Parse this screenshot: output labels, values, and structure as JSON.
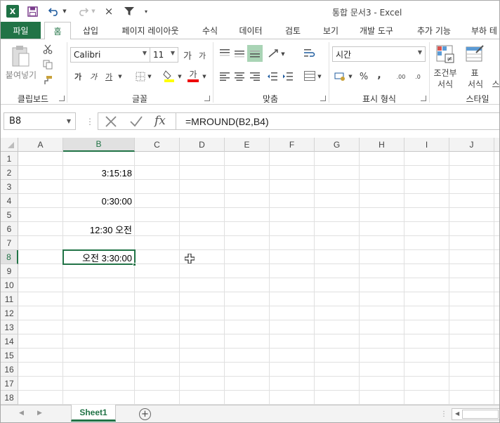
{
  "window": {
    "title": "통합 문서3 - Excel"
  },
  "qat": {
    "excel_icon": "X",
    "save_icon": "save-icon",
    "undo_icon": "undo-icon",
    "redo_icon": "redo-icon",
    "close_icon": "×",
    "filter_icon": "filter-icon"
  },
  "tabs": {
    "file": "파일",
    "items": [
      "홈",
      "삽입",
      "페이지 레이아웃",
      "수식",
      "데이터",
      "검토",
      "보기",
      "개발 도구",
      "추가 기능",
      "부하 테"
    ]
  },
  "ribbon": {
    "clipboard": {
      "paste": "붙여넣기",
      "label": "클립보드"
    },
    "font": {
      "name": "Calibri",
      "size": "11",
      "bold": "가",
      "italic": "가",
      "underline": "가",
      "grow": "가",
      "shrink": "가",
      "font_color": "가",
      "label": "글꼴"
    },
    "align": {
      "label": "맞춤"
    },
    "number": {
      "format": "시간",
      "percent": "%",
      "comma": ",",
      "label": "표시 형식",
      "dec_inc": ".00",
      "dec_dec": ".0"
    },
    "styles": {
      "cond_line1": "조건부",
      "cond_line2": "서식",
      "table_line1": "표",
      "table_line2": "서식",
      "cell_styles": "스",
      "label": "스타일"
    }
  },
  "formula_bar": {
    "name_box": "B8",
    "formula": "=MROUND(B2,B4)",
    "fx": "fx"
  },
  "grid": {
    "columns": [
      "A",
      "B",
      "C",
      "D",
      "E",
      "F",
      "G",
      "H",
      "I",
      "J"
    ],
    "rows": [
      "1",
      "2",
      "3",
      "4",
      "5",
      "6",
      "7",
      "8",
      "9",
      "10",
      "11",
      "12",
      "13",
      "14",
      "15",
      "16",
      "17",
      "18"
    ],
    "selected_cell": "B8",
    "cells": {
      "B2": "3:15:18",
      "B4": "0:30:00",
      "B6": "12:30 오전",
      "B8": "오전 3:30:00"
    }
  },
  "sheets": {
    "tabs": [
      "Sheet1"
    ],
    "add": "+"
  },
  "colors": {
    "accent": "#217346"
  }
}
